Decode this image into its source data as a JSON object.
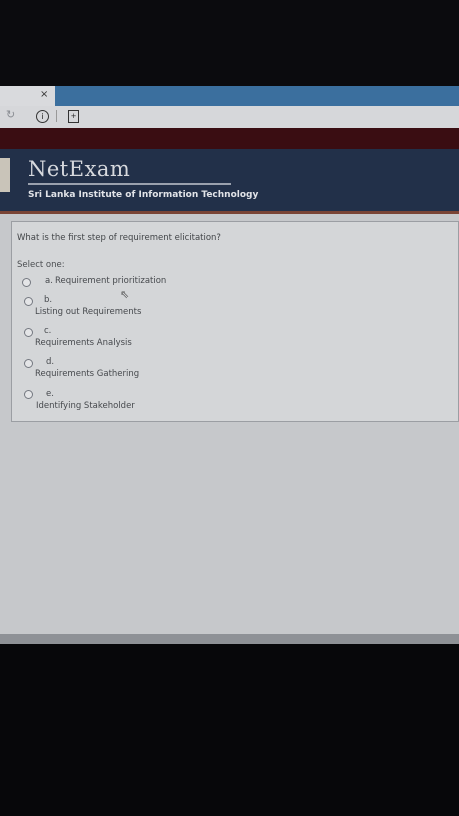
{
  "browser": {
    "tab_close": "×",
    "reload_icon": "↻",
    "info_icon": "i",
    "doc_icon": "+"
  },
  "header": {
    "brand": "NetExam",
    "institute": "Sri Lanka Institute of Information Technology"
  },
  "question": {
    "text": "What is the first step of requirement elicitation?",
    "select_label": "Select one:",
    "options": [
      {
        "letter": "a.",
        "text": "Requirement prioritization"
      },
      {
        "letter": "b.",
        "text": "Listing out Requirements"
      },
      {
        "letter": "c.",
        "text": "Requirements Analysis"
      },
      {
        "letter": "d.",
        "text": "Requirements Gathering"
      },
      {
        "letter": "e.",
        "text": "Identifying Stakeholder"
      }
    ]
  }
}
